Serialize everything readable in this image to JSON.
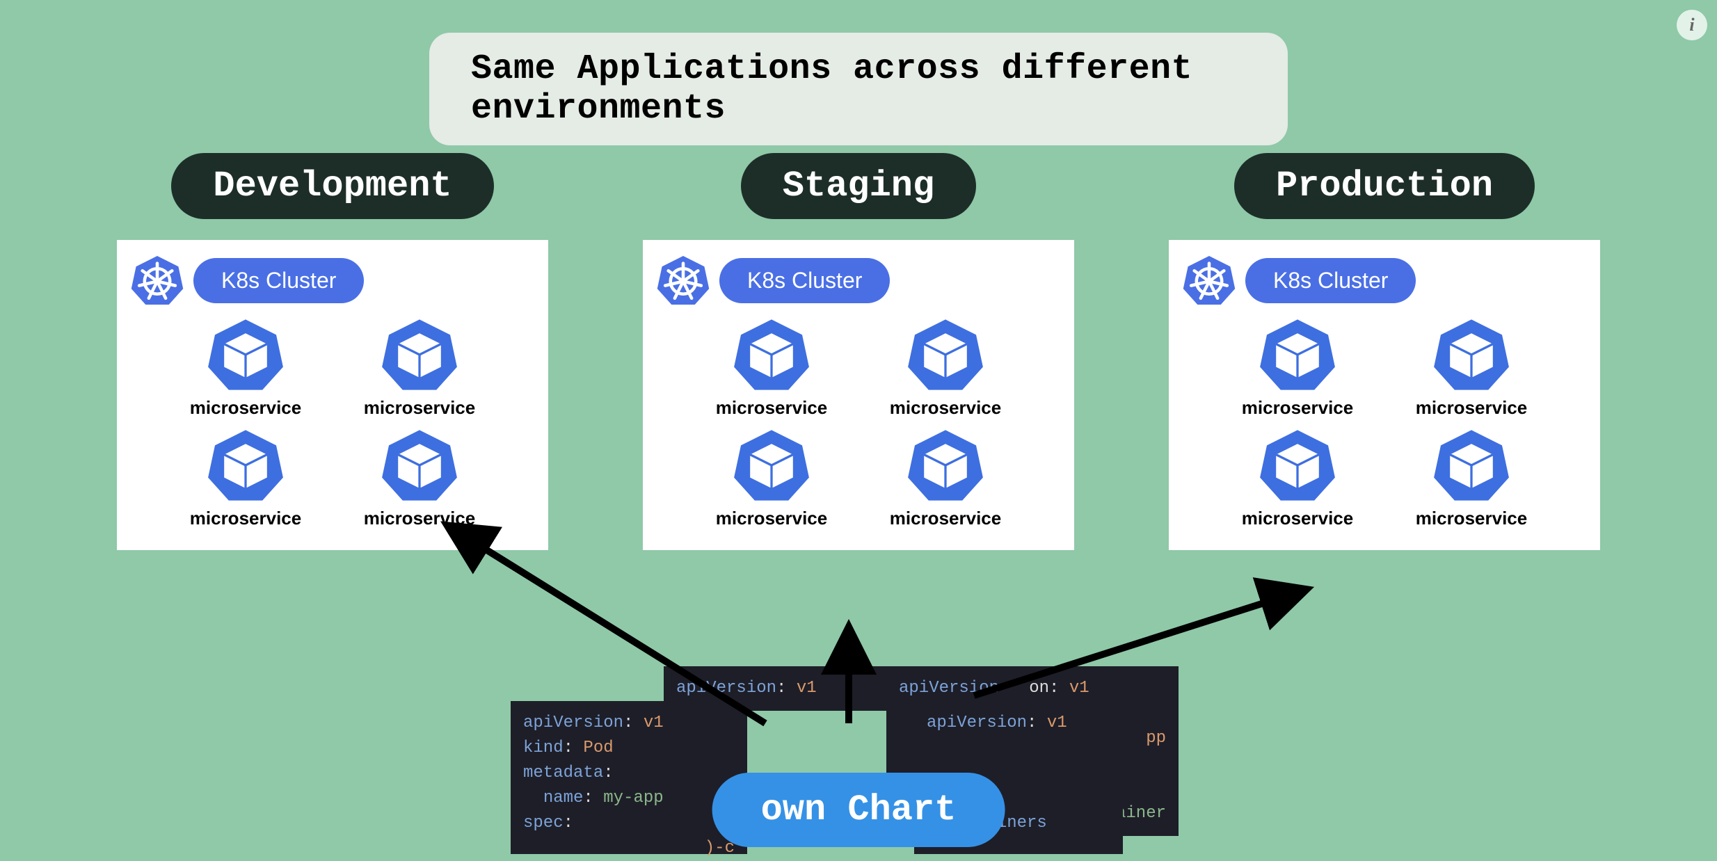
{
  "title": "Same Applications across different environments",
  "environments": [
    {
      "name": "Development",
      "cluster_label": "K8s Cluster",
      "services": [
        "microservice",
        "microservice",
        "microservice",
        "microservice"
      ]
    },
    {
      "name": "Staging",
      "cluster_label": "K8s Cluster",
      "services": [
        "microservice",
        "microservice",
        "microservice",
        "microservice"
      ]
    },
    {
      "name": "Production",
      "cluster_label": "K8s Cluster",
      "services": [
        "microservice",
        "microservice",
        "microservice",
        "microservice"
      ]
    }
  ],
  "chart_label": "own Chart",
  "yaml": {
    "apiVersion_key": "apiVersion",
    "apiVersion_val": "v1",
    "kind_key": "kind",
    "kind_val": "Pod",
    "metadata_key": "metadata",
    "name_key": "name",
    "name_val": "my-app",
    "spec_key": "spec",
    "containers_key": "containers",
    "app_container": "-app-container",
    "dash_c": ")-c",
    "pp": "pp"
  },
  "info_glyph": "i",
  "colors": {
    "bg": "#8fc9a8",
    "pill_dark": "#1d2e28",
    "k8s_blue": "#4a6fe5",
    "chart_blue": "#3591e6"
  }
}
